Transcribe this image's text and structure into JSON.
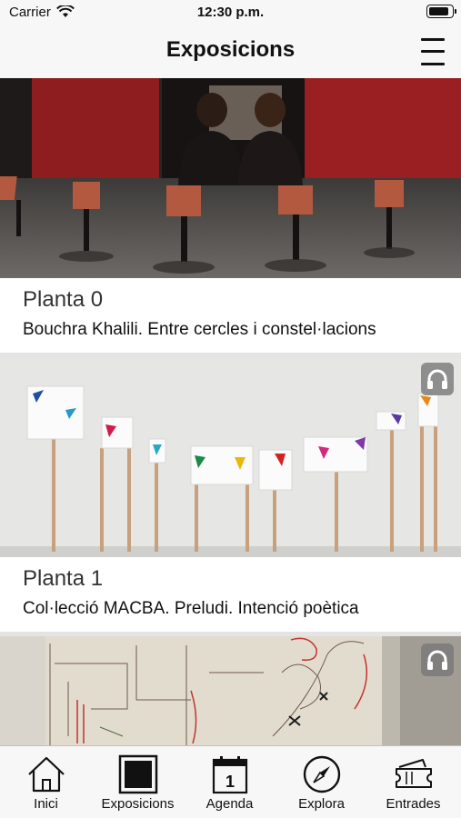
{
  "status_bar": {
    "carrier": "Carrier",
    "time": "12:30 p.m.",
    "battery_level": 0.9
  },
  "nav": {
    "title": "Exposicions",
    "menu_icon": "hamburger-menu-icon"
  },
  "exhibitions": [
    {
      "floor": "Planta 0",
      "title": "Bouchra Khalili. Entre cercles i constel·lacions",
      "audio_guide": false
    },
    {
      "floor": "Planta 1",
      "title": "Col·lecció MACBA. Preludi. Intenció poètica",
      "audio_guide": true,
      "audio_icon": "headphones-icon"
    },
    {
      "audio_guide": true,
      "audio_icon": "headphones-icon"
    }
  ],
  "tabs": [
    {
      "label": "Inici",
      "icon": "home-icon"
    },
    {
      "label": "Exposicions",
      "icon": "exhibitions-icon",
      "active": true
    },
    {
      "label": "Agenda",
      "icon": "calendar-icon",
      "calendar_day": "1"
    },
    {
      "label": "Explora",
      "icon": "compass-icon"
    },
    {
      "label": "Entrades",
      "icon": "tickets-icon"
    }
  ],
  "colors": {
    "bar_background": "#f7f7f7",
    "list_background": "#e4e4e4",
    "card_background": "#ffffff",
    "text": "#111111",
    "badge": "#787878"
  }
}
